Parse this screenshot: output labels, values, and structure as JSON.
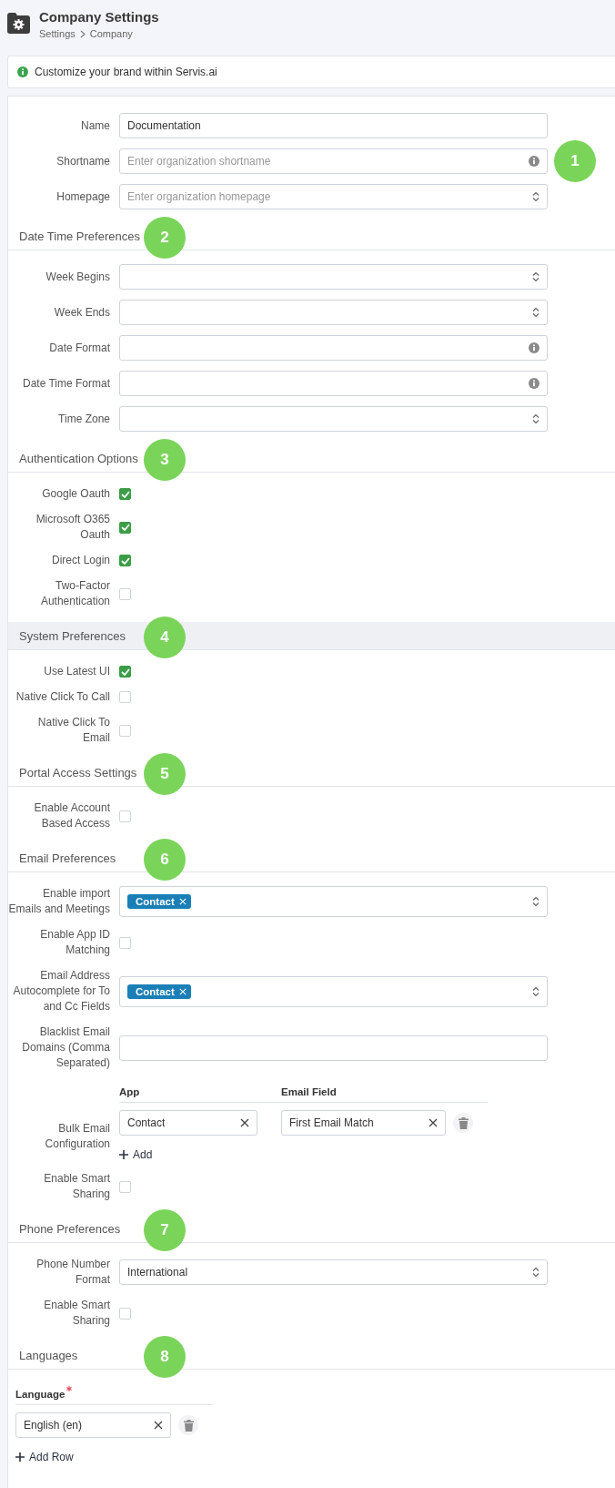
{
  "header": {
    "title": "Company Settings",
    "breadcrumb": [
      "Settings",
      "Company"
    ]
  },
  "notice": "Customize your brand within Servis.ai",
  "sections": [
    {
      "rows": [
        {
          "kind": "input",
          "label": "Name",
          "value": "Documentation"
        },
        {
          "kind": "input",
          "label": "Shortname",
          "placeholder": "Enter organization shortname",
          "info": true,
          "marker": "1"
        },
        {
          "kind": "select",
          "label": "Homepage",
          "placeholder": "Enter organization homepage"
        }
      ]
    },
    {
      "title": "Date Time Preferences",
      "marker": "2",
      "rows": [
        {
          "kind": "select",
          "label": "Week Begins"
        },
        {
          "kind": "select",
          "label": "Week Ends"
        },
        {
          "kind": "input",
          "label": "Date Format",
          "info": true
        },
        {
          "kind": "input",
          "label": "Date Time Format",
          "info": true
        },
        {
          "kind": "select",
          "label": "Time Zone"
        }
      ]
    },
    {
      "title": "Authentication Options",
      "marker": "3",
      "rows": [
        {
          "kind": "checkbox",
          "label": "Google Oauth",
          "checked": true
        },
        {
          "kind": "checkbox",
          "label": "Microsoft O365 Oauth",
          "checked": true
        },
        {
          "kind": "checkbox",
          "label": "Direct Login",
          "checked": true
        },
        {
          "kind": "checkbox",
          "label": "Two-Factor Authentication",
          "checked": false
        }
      ]
    },
    {
      "title": "System Preferences",
      "marker": "4",
      "highlighted": true,
      "rows": [
        {
          "kind": "checkbox",
          "label": "Use Latest UI",
          "checked": true
        },
        {
          "kind": "checkbox",
          "label": "Native Click To Call",
          "checked": false
        },
        {
          "kind": "checkbox",
          "label": "Native Click To Email",
          "checked": false
        }
      ]
    },
    {
      "title": "Portal Access Settings",
      "marker": "5",
      "rows": [
        {
          "kind": "checkbox",
          "label": "Enable Account Based Access",
          "checked": false
        }
      ]
    },
    {
      "title": "Email Preferences",
      "marker": "6",
      "rows": [
        {
          "kind": "tags",
          "label": "Enable import Emails and Meetings",
          "tags": [
            "Contact"
          ]
        },
        {
          "kind": "checkbox",
          "label": "Enable App ID Matching",
          "checked": false
        },
        {
          "kind": "tags",
          "label": "Email Address Autocomplete for To and Cc Fields",
          "tags": [
            "Contact"
          ]
        },
        {
          "kind": "input",
          "label": "Blacklist Email Domains (Comma Separated)"
        },
        {
          "kind": "table",
          "label": "Bulk Email Configuration",
          "columns": [
            {
              "label": "App"
            },
            {
              "label": "Email Field"
            }
          ],
          "rows": [
            [
              "Contact",
              "First Email Match"
            ]
          ],
          "add": "Add"
        },
        {
          "kind": "checkbox",
          "label": "Enable Smart Sharing",
          "checked": false
        }
      ]
    },
    {
      "title": "Phone Preferences",
      "marker": "7",
      "rows": [
        {
          "kind": "select",
          "label": "Phone Number Format",
          "value": "International"
        },
        {
          "kind": "checkbox",
          "label": "Enable Smart Sharing",
          "checked": false
        }
      ]
    },
    {
      "title": "Languages",
      "marker": "8",
      "rows": [
        {
          "kind": "table",
          "columns": [
            {
              "label": "Language",
              "required": true
            }
          ],
          "rows": [
            [
              "English (en)"
            ]
          ],
          "add": "Add Row"
        }
      ]
    }
  ]
}
